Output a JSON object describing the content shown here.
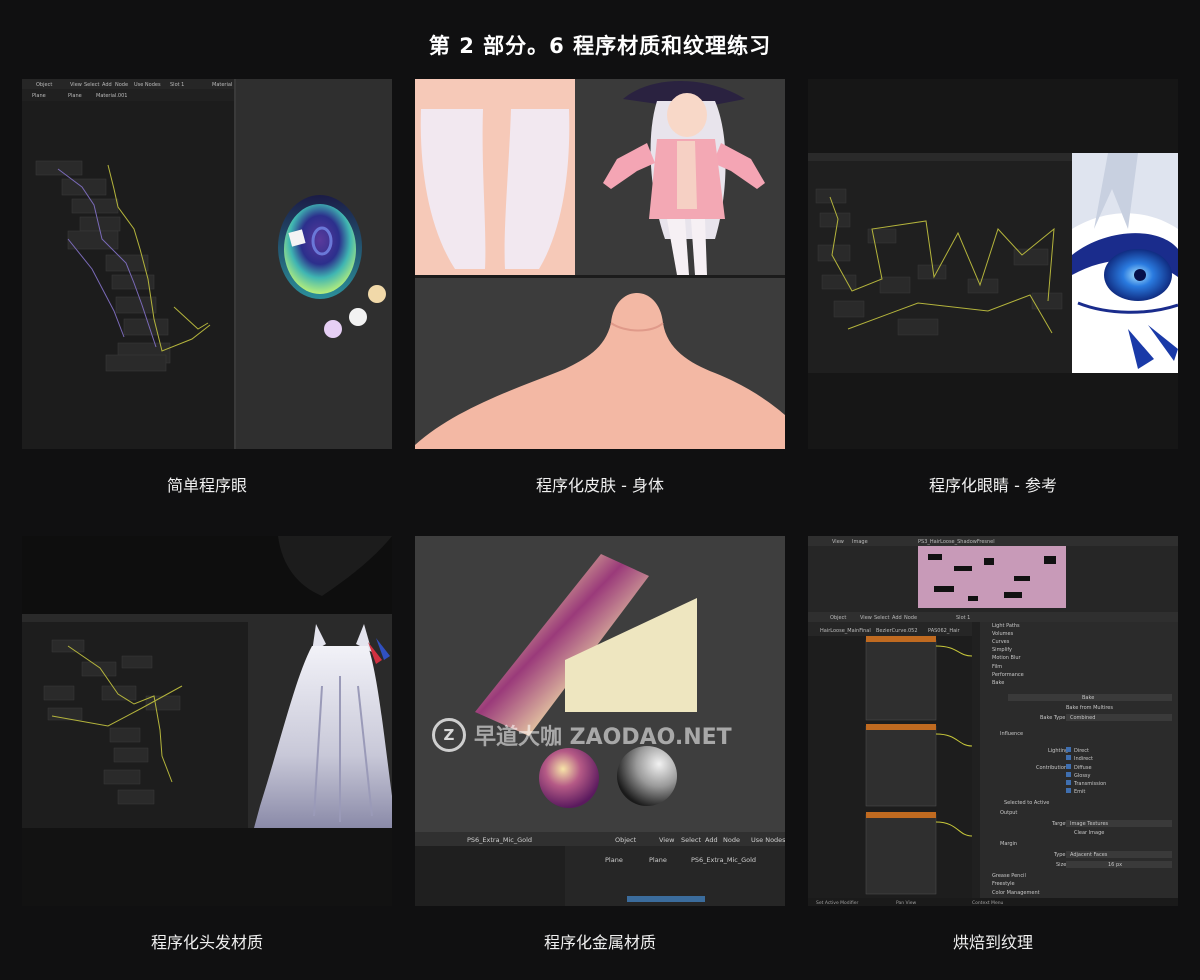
{
  "page": {
    "title": "第 2 部分。6 程序材质和纹理练习"
  },
  "tiles": [
    {
      "caption": "简单程序眼",
      "ui": {
        "mode": "Object",
        "menu": [
          "View",
          "Select",
          "Add",
          "Node"
        ],
        "use_nodes": "Use Nodes",
        "slot": "Slot 1",
        "material": "Material",
        "breadcrumb": [
          "Plane",
          "Plane",
          "Material.001"
        ]
      }
    },
    {
      "caption": "程序化皮肤 - 身体"
    },
    {
      "caption": "程序化眼睛 - 参考"
    },
    {
      "caption": "程序化头发材质"
    },
    {
      "caption": "程序化金属材质",
      "ui": {
        "material_name": "PS6_Extra_Mic_Gold",
        "mode": "Object",
        "menu": [
          "View",
          "Select",
          "Add",
          "Node"
        ],
        "use_nodes": "Use Nodes",
        "breadcrumb": [
          "Plane",
          "Plane",
          "PS6_Extra_Mic_Gold"
        ]
      }
    },
    {
      "caption": "烘焙到纹理",
      "ui": {
        "image_menu": [
          "View",
          "Image"
        ],
        "image_name": "PS3_HairLoose_ShadowFresnel",
        "mode": "Object",
        "menu": [
          "View",
          "Select",
          "Add",
          "Node"
        ],
        "slot": "Slot 1",
        "breadcrumb": [
          "HairLoose_MainFinal",
          "BezierCurve.052",
          "PAS062_Hair"
        ],
        "props": [
          "Light Paths",
          "Volumes",
          "Curves",
          "Simplify",
          "Motion Blur",
          "Film",
          "Performance",
          "Bake",
          "Bake",
          "Bake from Multires",
          "Bake Type",
          "Combined",
          "Influence",
          "Lighting",
          "Direct",
          "Indirect",
          "Contributions",
          "Diffuse",
          "Glossy",
          "Transmission",
          "Emit",
          "Selected to Active",
          "Output",
          "Target",
          "Image Textures",
          "Clear Image",
          "Margin",
          "Type",
          "Adjacent Faces",
          "Size",
          "16 px",
          "Grease Pencil",
          "Freestyle",
          "Color Management"
        ],
        "status": [
          "Set Active Modifier",
          "Pan View",
          "Context Menu"
        ]
      }
    }
  ],
  "watermark": {
    "text": "早道大咖 ZAODAO.NET",
    "badge": "Z"
  },
  "colors": {
    "background": "#101011",
    "panel": "#2d2d2d",
    "node_editor": "#1d1d1d",
    "wire_yellow": "#b4b43c",
    "wire_purple": "#7a6ab8"
  }
}
